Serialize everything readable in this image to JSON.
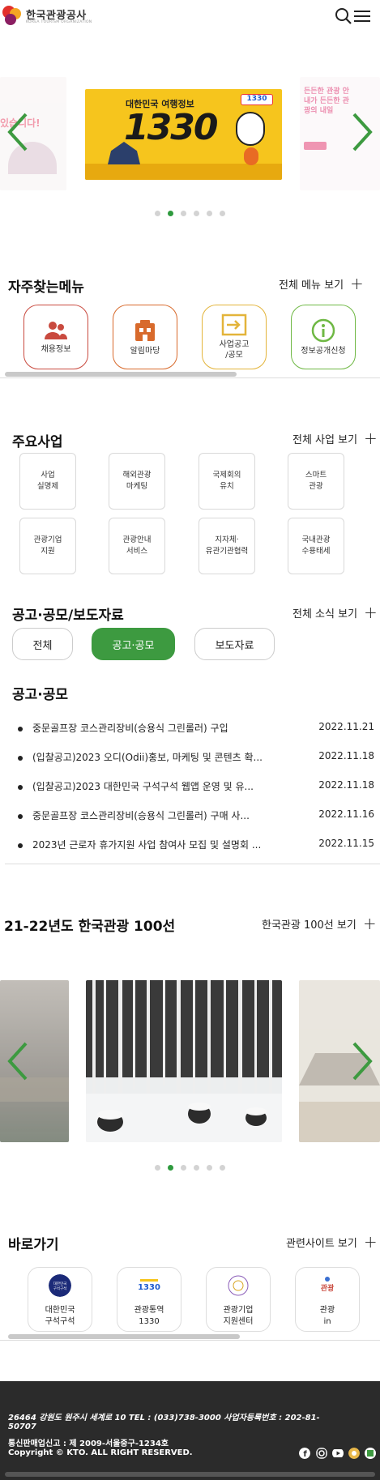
{
  "header": {
    "logo_text": "한국관광공사",
    "logo_sub": "KOREA TOURISM ORGANIZATION"
  },
  "hero_slider": {
    "slide_main": {
      "line1": "대한민국 여행정보",
      "big_number": "1330",
      "tag": "1330"
    },
    "slide_right_text": "든든한 관광 안내가 든든한 관광의 내일",
    "slide_left_text": "있습니다!",
    "active_index": 1,
    "count": 6
  },
  "quick_menu": {
    "title": "자주찾는메뉴",
    "all_link": "전체 메뉴 보기",
    "items": [
      {
        "label": "채용정보",
        "icon": "people-icon",
        "color": "#c94a3f"
      },
      {
        "label": "알림마당",
        "icon": "building-icon",
        "color": "#d86a2c"
      },
      {
        "label": "사업공고\n/공모",
        "icon": "login-arrow-icon",
        "color": "#e3b43a"
      },
      {
        "label": "정보공개신청",
        "icon": "info-icon",
        "color": "#6fb844"
      }
    ]
  },
  "business": {
    "title": "주요사업",
    "all_link": "전체 사업 보기",
    "items": [
      "사업\n실명제",
      "해외관광\n마케팅",
      "국제회의\n유치",
      "스마트\n관광",
      "관광기업\n지원",
      "관광안내\n서비스",
      "지자체·\n유관기관협력",
      "국내관광\n수용태세"
    ]
  },
  "notice": {
    "title": "공고·공모/보도자료",
    "all_link": "전체 소식 보기",
    "tabs": [
      "전체",
      "공고·공모",
      "보도자료"
    ],
    "active_tab": 1,
    "sub_title": "공고·공모",
    "items": [
      {
        "title": "중문골프장 코스관리장비(승용식 그린롤러) 구입",
        "date": "2022.11.21"
      },
      {
        "title": "(입찰공고)2023 오디(Odii)홍보, 마케팅 및 콘텐츠 확...",
        "date": "2022.11.18"
      },
      {
        "title": "(입찰공고)2023 대한민국 구석구석 웹앱 운영 및 유...",
        "date": "2022.11.18"
      },
      {
        "title": "중문골프장 코스관리장비(승용식 그린롤러) 구매 사...",
        "date": "2022.11.16"
      },
      {
        "title": "2023년 근로자 휴가지원 사업 참여사 모집 및 설명회 ...",
        "date": "2022.11.15"
      }
    ]
  },
  "tour100": {
    "title": "21-22년도 한국관광 100선",
    "all_link": "한국관광 100선 보기",
    "active_index": 1,
    "count": 6
  },
  "shortcuts": {
    "title": "바로가기",
    "all_link": "관련사이트 보기",
    "items": [
      {
        "label": "대한민국\n구석구석",
        "icon": "visitkorea-logo-icon"
      },
      {
        "label": "관광통역\n1330",
        "icon": "1330-logo-icon"
      },
      {
        "label": "관광기업\n지원센터",
        "icon": "tourism-support-logo-icon"
      },
      {
        "label": "관광\nin",
        "icon": "tourism-in-logo-icon"
      }
    ]
  },
  "footer": {
    "address": "26464 강원도 원주시 세계로 10 TEL : (033)738-3000 사업자등록번호 : 202-81-",
    "address2": "50707",
    "license": "통신판매업신고 : 제 2009-서울중구-1234호",
    "copyright": "Copyright © KTO. ALL RIGHT RESERVED."
  },
  "colors": {
    "accent_green": "#3d9a40",
    "footer_bg": "#2b2b2b"
  }
}
